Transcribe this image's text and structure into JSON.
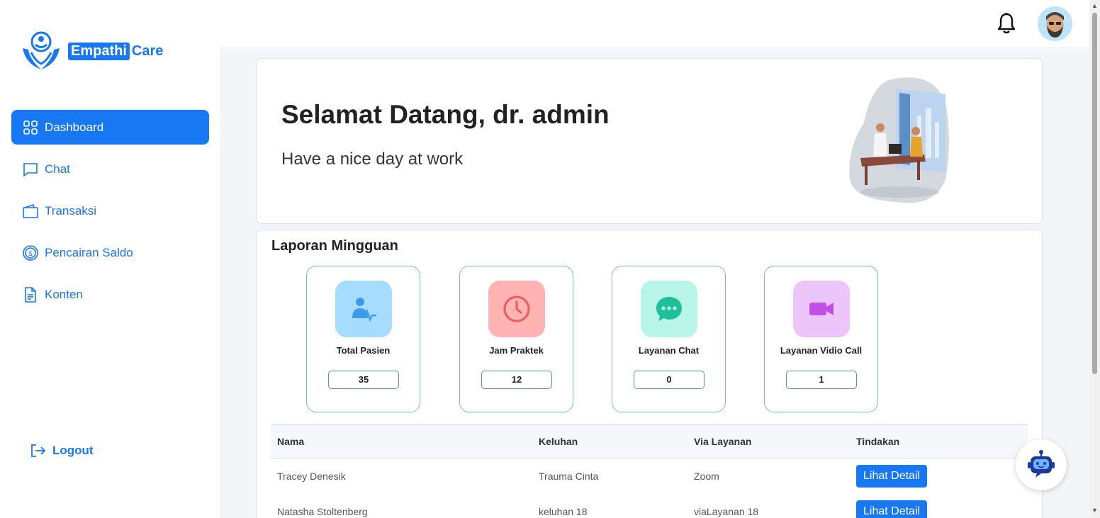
{
  "brand": {
    "part1": "Empathi",
    "part2": "Care"
  },
  "sidebar": {
    "items": [
      {
        "label": "Dashboard",
        "icon": "grid-icon",
        "active": true
      },
      {
        "label": "Chat",
        "icon": "chat-icon"
      },
      {
        "label": "Transaksi",
        "icon": "wallet-icon"
      },
      {
        "label": "Pencairan Saldo",
        "icon": "dollar-icon"
      },
      {
        "label": "Konten",
        "icon": "document-icon"
      }
    ],
    "logout": "Logout"
  },
  "welcome": {
    "title": "Selamat Datang, dr. admin",
    "subtitle": "Have a nice day at work"
  },
  "report": {
    "title": "Laporan Mingguan",
    "cards": [
      {
        "label": "Total Pasien",
        "value": "35",
        "icon": "patient-icon",
        "bg": "#a6dcff",
        "fg": "#3b9be8"
      },
      {
        "label": "Jam Praktek",
        "value": "12",
        "icon": "clock-icon",
        "bg": "#ffb3b3",
        "fg": "#f05a5a"
      },
      {
        "label": "Layanan Chat",
        "value": "0",
        "icon": "chat-bubble-icon",
        "bg": "#b8f5e6",
        "fg": "#1fbf99"
      },
      {
        "label": "Layanan Vidio Call",
        "value": "1",
        "icon": "video-icon",
        "bg": "#ecc5fb",
        "fg": "#c04fe8"
      }
    ]
  },
  "table": {
    "headers": [
      "Nama",
      "Keluhan",
      "Via Layanan",
      "Tindakan"
    ],
    "rows": [
      {
        "nama": "Tracey Denesik",
        "keluhan": "Trauma Cinta",
        "via": "Zoom",
        "action": "Lihat Detail"
      },
      {
        "nama": "Natasha Stoltenberg",
        "keluhan": "keluhan 18",
        "via": "viaLayanan 18",
        "action": "Lihat Detail"
      }
    ]
  },
  "colors": {
    "accent": "#1877f2",
    "background": "#f3f5f8"
  }
}
